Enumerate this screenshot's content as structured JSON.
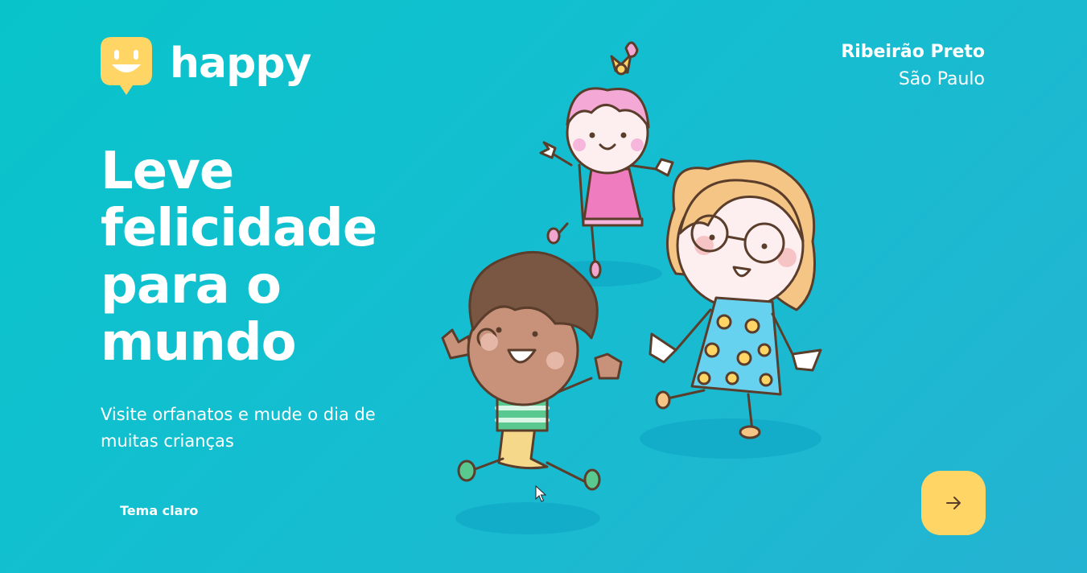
{
  "brand": {
    "name": "happy",
    "logo_icon": "smiley-speech-bubble-icon",
    "logo_color": "#ffd666"
  },
  "location": {
    "city": "Ribeirão Preto",
    "state": "São Paulo"
  },
  "hero": {
    "headline": "Leve felicidade para o mundo",
    "subtitle": "Visite orfanatos e mude o dia de muitas crianças"
  },
  "theme_toggle": {
    "label": "Tema claro"
  },
  "enter_button": {
    "icon": "arrow-right-icon",
    "color": "#ffd666"
  },
  "illustration": {
    "icon": "happy-children-illustration"
  },
  "colors": {
    "background_start": "#08c4ca",
    "background_end": "#25b3d2",
    "accent": "#ffd666",
    "text": "#ffffff"
  }
}
